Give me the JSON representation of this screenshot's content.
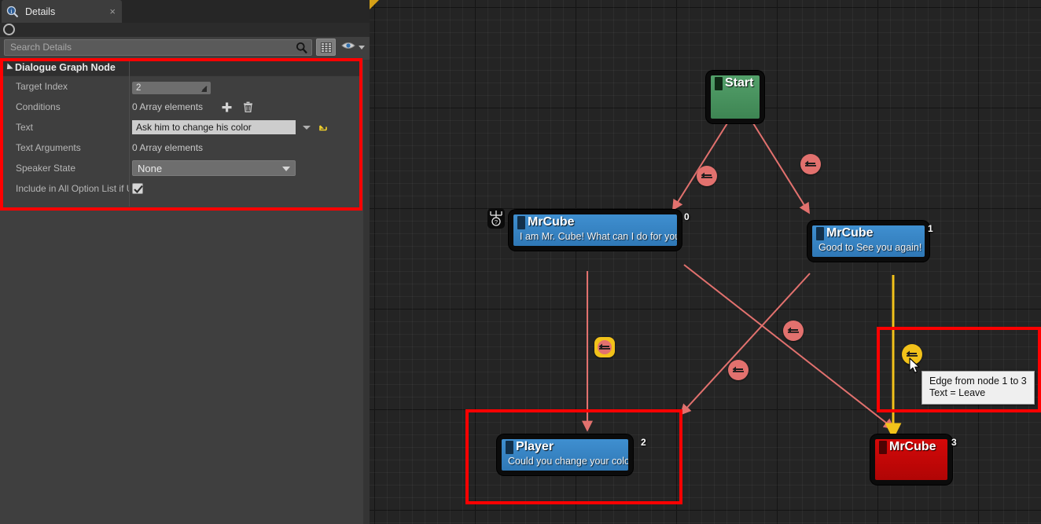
{
  "details_panel": {
    "tab": {
      "label": "Details",
      "icon": "details-magnifier-icon",
      "close": "×"
    },
    "lock_toggle_name": "lock-details-toggle",
    "search": {
      "value": "",
      "placeholder": "Search Details"
    },
    "toolbar": {
      "grid_view_button": "grid-view-button",
      "visibility_button": "visibility-eye-button"
    },
    "category": {
      "title": "Dialogue Graph Node"
    },
    "rows": [
      {
        "label": "Target Index",
        "type": "number",
        "value": "2"
      },
      {
        "label": "Conditions",
        "type": "array",
        "value": "0 Array elements"
      },
      {
        "label": "Text",
        "type": "text",
        "value": "Ask him to change his color"
      },
      {
        "label": "Text Arguments",
        "type": "array_ro",
        "value": "0 Array elements"
      },
      {
        "label": "Speaker State",
        "type": "combo",
        "value": "None"
      },
      {
        "label": "Include in All Option List if U",
        "type": "checkbox",
        "value": "true"
      }
    ]
  },
  "graph": {
    "nodes": [
      {
        "id": "start",
        "title": "Start",
        "body": "",
        "index": "",
        "color": "green",
        "swatch": "#102a16"
      },
      {
        "id": "n0",
        "title": "MrCube",
        "body": "I am Mr. Cube! What can I do for you?",
        "index": "0",
        "color": "blue",
        "swatch": "#12304a"
      },
      {
        "id": "n1",
        "title": "MrCube",
        "body": "Good to See you again!",
        "index": "1",
        "color": "blue",
        "swatch": "#12304a"
      },
      {
        "id": "n2",
        "title": "Player",
        "body": "Could you change your color?",
        "index": "2",
        "color": "blue",
        "swatch": "#12304a"
      },
      {
        "id": "n3",
        "title": "MrCube",
        "body": "",
        "index": "3",
        "color": "red",
        "swatch": "#4d0303"
      }
    ],
    "edge_icons": [
      {
        "id": "e-start-0",
        "state": "normal"
      },
      {
        "id": "e-start-1",
        "state": "normal"
      },
      {
        "id": "e-0-2",
        "state": "selected"
      },
      {
        "id": "e-0-3",
        "state": "normal"
      },
      {
        "id": "e-1-2",
        "state": "normal"
      },
      {
        "id": "e-1-3",
        "state": "hovered"
      }
    ],
    "tooltip": {
      "line1": "Edge from node 1 to 3",
      "line2": "Text = Leave"
    },
    "colors": {
      "edge_red": "#e2716e",
      "edge_yellow": "#f2c21a",
      "annotation": "#ff0000",
      "background": "#242424"
    },
    "root_badge_name": "root-node-badge-icon"
  }
}
